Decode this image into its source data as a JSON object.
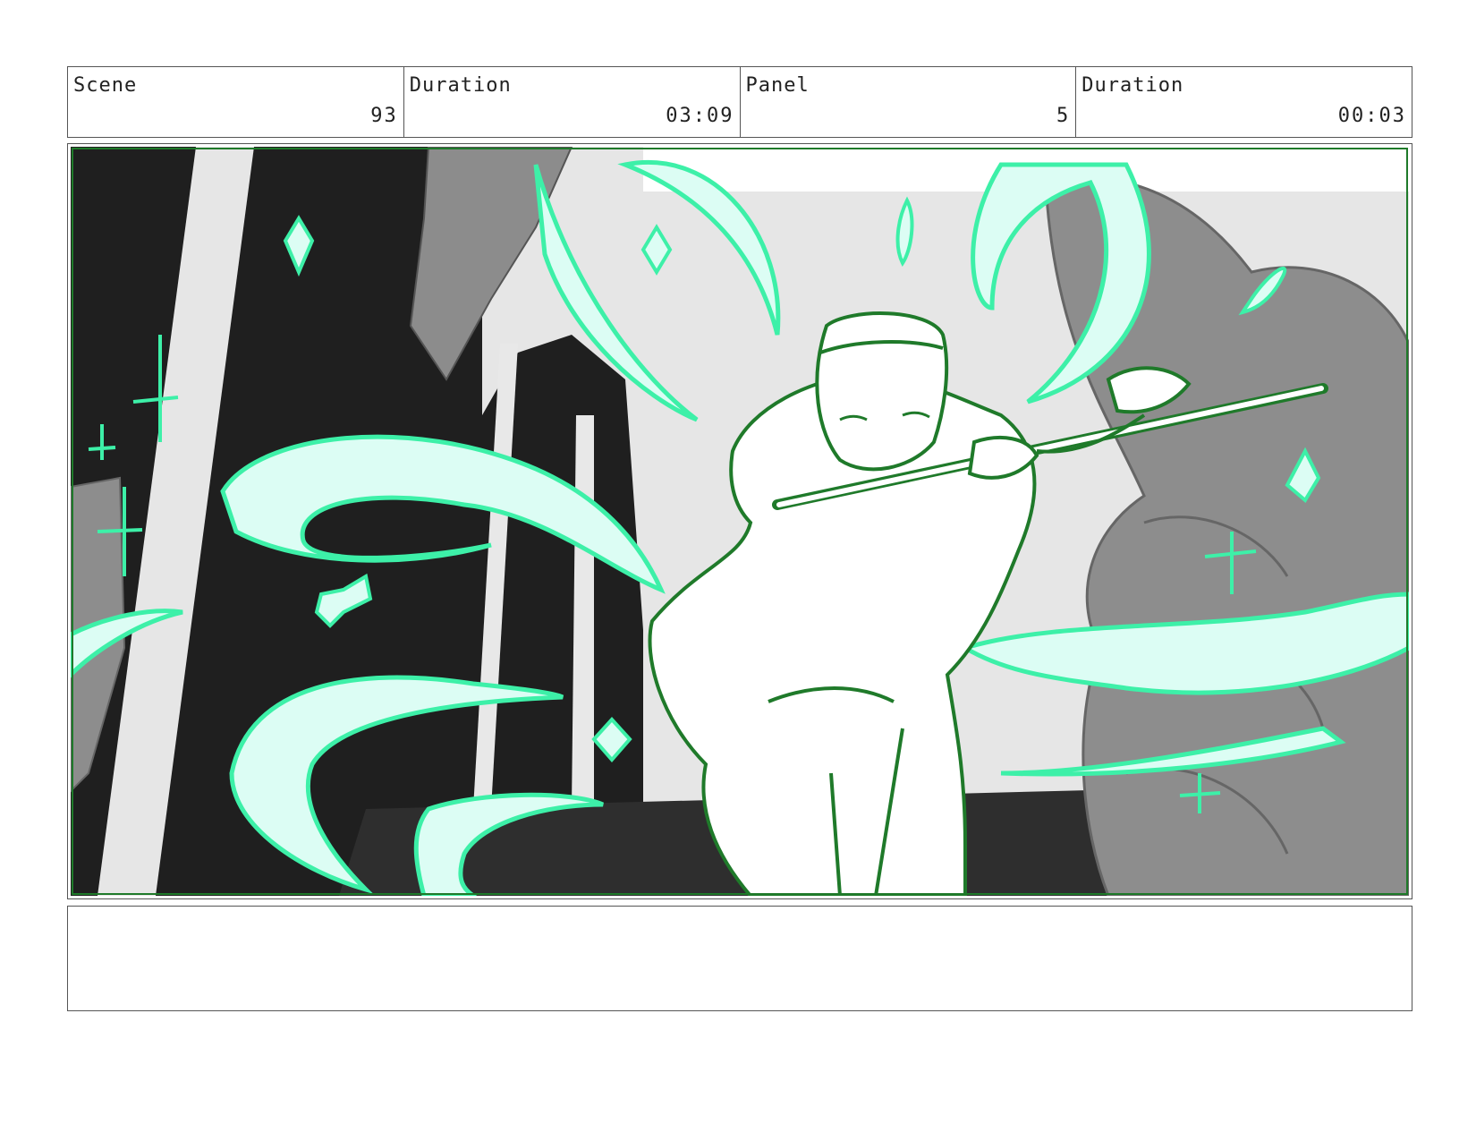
{
  "header": {
    "scene_label": "Scene",
    "scene_value": "93",
    "duration_label": "Duration",
    "duration_value": "03:09",
    "panel_label": "Panel",
    "panel_value": "5",
    "panel_duration_label": "Duration",
    "panel_duration_value": "00:03"
  },
  "notes": {
    "text": ""
  },
  "colors": {
    "glow_stroke": "#3df0a8",
    "glow_fill": "#dcfdf4",
    "character_line": "#1f7a2a",
    "dark_bg": "#1f1f1f",
    "mid_gray": "#8a8a8a",
    "light_gray": "#e6e6e6"
  }
}
